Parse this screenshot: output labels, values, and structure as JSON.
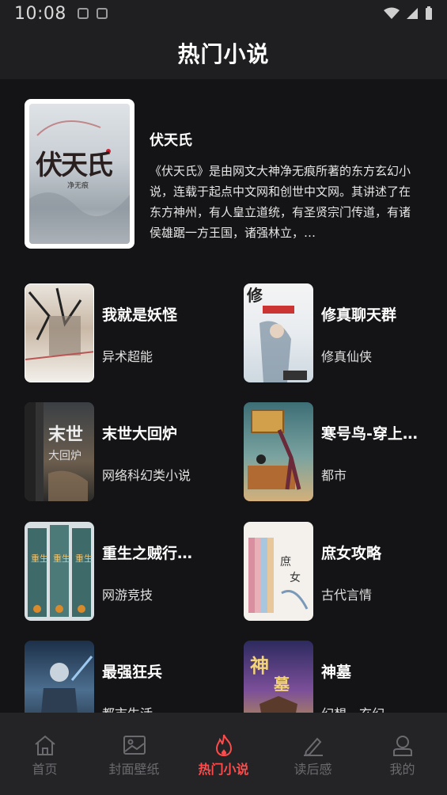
{
  "status_bar": {
    "time": "10:08"
  },
  "header": {
    "title": "热门小说"
  },
  "featured": {
    "title": "伏天氏",
    "description": "《伏天氏》是由网文大神净无痕所著的东方玄幻小说，连载于起点中文网和创世中文网。其讲述了在东方神州，有人皇立道统，有圣贤宗门传道，有诸侯雄踞一方王国，诸强林立，…",
    "cover_text": "伏天氏",
    "cover_sub": "净无痕"
  },
  "books": [
    {
      "title": "我就是妖怪",
      "genre": "异术超能"
    },
    {
      "title": "修真聊天群",
      "genre": "修真仙侠"
    },
    {
      "title": "末世大回炉",
      "genre": "网络科幻类小说"
    },
    {
      "title": "寒号鸟-穿上…",
      "genre": "都市"
    },
    {
      "title": "重生之贼行…",
      "genre": "网游竞技"
    },
    {
      "title": "庶女攻略",
      "genre": "古代言情"
    },
    {
      "title": "最强狂兵",
      "genre": "都市生活"
    },
    {
      "title": "神墓",
      "genre": "幻想，玄幻"
    }
  ],
  "tabs": [
    {
      "label": "首页",
      "icon": "home-icon"
    },
    {
      "label": "封面壁纸",
      "icon": "image-icon"
    },
    {
      "label": "热门小说",
      "icon": "fire-icon",
      "active": true
    },
    {
      "label": "读后感",
      "icon": "pen-icon"
    },
    {
      "label": "我的",
      "icon": "user-icon"
    }
  ],
  "colors": {
    "accent": "#ff4b4b",
    "background": "#141416",
    "header": "#1f1f21",
    "tab_bar": "#242426",
    "inactive": "#6b6b6f"
  }
}
